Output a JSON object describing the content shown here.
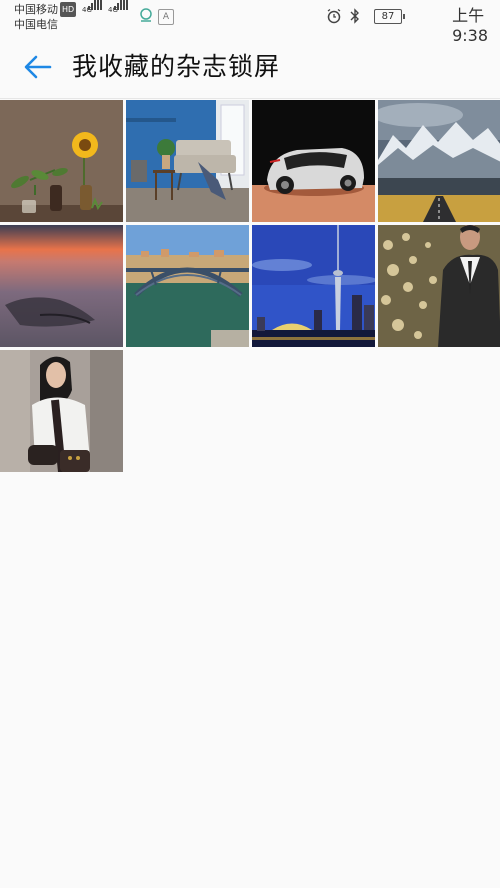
{
  "status_bar": {
    "carrier1": "中国移动",
    "carrier1_badge": "HD",
    "carrier2": "中国电信",
    "net1": "4G",
    "net2": "4G",
    "a_label": "A",
    "battery": "87",
    "time": "上午9:38"
  },
  "header": {
    "title": "我收藏的杂志锁屏"
  },
  "wallpapers": [
    {
      "subject": "sunflower-vase"
    },
    {
      "subject": "living-room"
    },
    {
      "subject": "concept-car"
    },
    {
      "subject": "snowy-mountains-road"
    },
    {
      "subject": "sunset-coast"
    },
    {
      "subject": "arch-bridge-city"
    },
    {
      "subject": "city-tower-skyline"
    },
    {
      "subject": "man-in-suit"
    },
    {
      "subject": "woman-fashion"
    }
  ],
  "colors": {
    "accent": "#1e88e5",
    "background": "#fafafa"
  }
}
